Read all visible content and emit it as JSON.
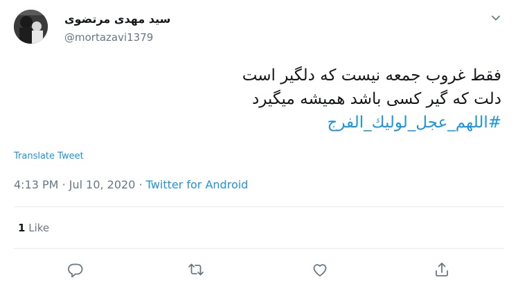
{
  "user": {
    "display_name": "سید مهدی مرتضوی",
    "handle": "@mortazavi1379"
  },
  "tweet": {
    "lines": [
      "فقط غروب جمعه نیست که دلگیر است",
      "دلت که گیر کسی باشد همیشه میگیرد"
    ],
    "hashtag": "#اللهم_عجل_لوليك_الفرج",
    "translate_label": "Translate Tweet",
    "time": "4:13 PM",
    "separator": "·",
    "date": "Jul 10, 2020",
    "source": "Twitter for Android"
  },
  "stats": {
    "like_count": "1",
    "like_label": "Like"
  },
  "icons": {
    "more": "chevron-down-icon",
    "reply": "reply-icon",
    "retweet": "retweet-icon",
    "like": "heart-icon",
    "share": "share-icon"
  },
  "colors": {
    "link": "#1b95e0",
    "secondary_text": "#657786",
    "primary_text": "#14171a",
    "divider": "#e6ecf0"
  }
}
